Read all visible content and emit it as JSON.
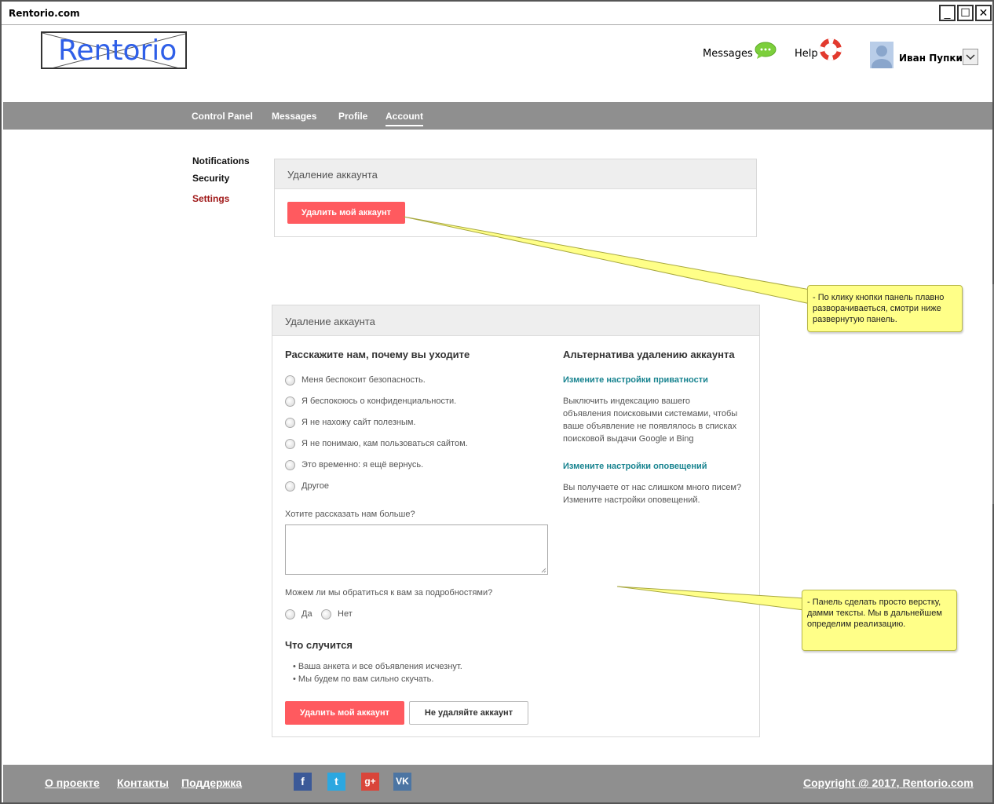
{
  "window": {
    "title": "Rentorio.com",
    "controls": [
      "_",
      "☐",
      "✕"
    ]
  },
  "header": {
    "logo_text": "Rentorio",
    "messages_label": "Messages",
    "help_label": "Help",
    "user_name": "Иван Пупкин"
  },
  "nav": {
    "items": [
      "Control Panel",
      "Messages",
      "Profile",
      "Account"
    ],
    "active": "Account"
  },
  "sidebar": {
    "items": [
      "Notifications",
      "Security",
      "Settings"
    ],
    "active": "Settings"
  },
  "panel1": {
    "title": "Удаление аккаунта",
    "delete_button": "Удалить мой аккаунт"
  },
  "panel2": {
    "title": "Удаление аккаунта",
    "reasons_heading": "Расскажите нам, почему вы уходите",
    "reasons": [
      "Меня беспокоит безопасность.",
      "Я беспокоюсь о конфиденциальности.",
      "Я не нахожу сайт полезным.",
      "Я не понимаю, кам пользоваться сайтом.",
      "Это временно: я ещё вернусь.",
      "Другое"
    ],
    "more_label": "Хотите рассказать нам больше?",
    "contact_question": "Можем ли мы обратиться к вам за подробностями?",
    "contact_yes": "Да",
    "contact_no": "Нет",
    "happens_heading": "Что случится",
    "happens_items": [
      "Ваша анкета и все объявления исчезнут.",
      "Мы будем по вам сильно скучать."
    ],
    "delete_button": "Удалить мой аккаунт",
    "keep_button": "Не удаляйте аккаунт",
    "alt_heading": "Альтернатива удалению аккаунта",
    "privacy_link": "Измените настройки приватности",
    "privacy_text": [
      "Выключить индексацию вашего",
      "объявления поисковыми системами, чтобы",
      "ваше объявление не появлялось в списках",
      "поисковой выдачи Google и Bing"
    ],
    "notify_link": "Измените настройки оповещений",
    "notify_text": [
      "Вы получаете от нас слишком много писем?",
      "Измените настройки оповещений."
    ]
  },
  "notes": {
    "note1": [
      "- По клику кнопки панель плавно",
      "разворачиваеться, смотри ниже",
      "развернутую панель."
    ],
    "note2": [
      "- Панель сделать просто верстку,",
      "дамми тексты. Мы в дальнейшем",
      "определим  реализацию."
    ]
  },
  "footer": {
    "links": [
      "О проекте",
      "Контакты",
      "Поддержка"
    ],
    "social": [
      {
        "icon": "facebook-icon",
        "glyph": "f",
        "color": "#3b5998"
      },
      {
        "icon": "twitter-icon",
        "glyph": "t",
        "color": "#2ca7e0"
      },
      {
        "icon": "google-plus-icon",
        "glyph": "g+",
        "color": "#d9453a"
      },
      {
        "icon": "vk-icon",
        "glyph": "VK",
        "color": "#4c75a3"
      }
    ],
    "copyright": "Copyright @ 2017, Rentorio.com"
  }
}
